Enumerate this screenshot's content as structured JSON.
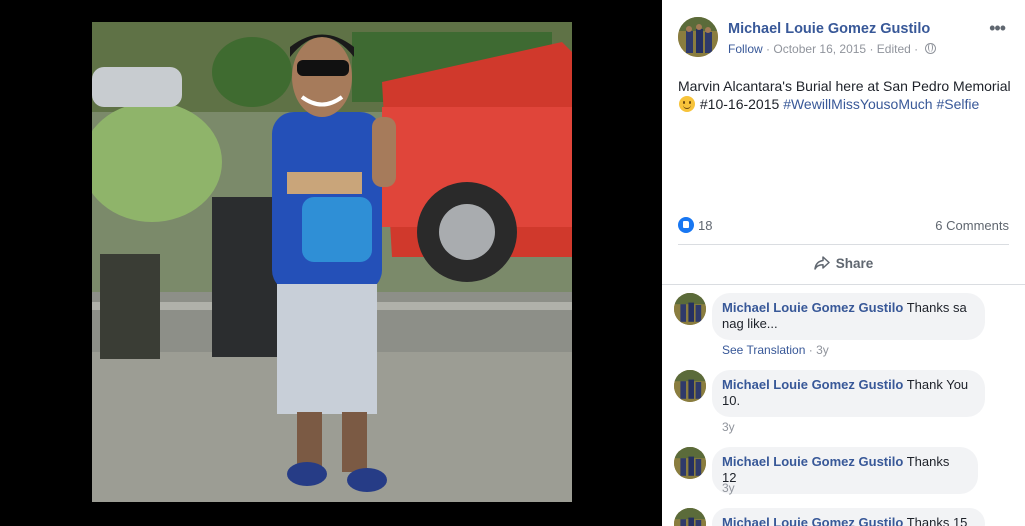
{
  "post": {
    "author": "Michael Louie Gomez Gustilo",
    "follow_label": "Follow",
    "date": "October 16, 2015",
    "edited_label": "Edited",
    "separator": "·",
    "more_icon": "more-options-icon",
    "text_main": "Marvin Alcantara's Burial here at San Pedro Memorial",
    "text_after_emoji": "#10-16-2015",
    "hashtag1": "#WewillMissYousoMuch",
    "hashtag2": "#Selfie"
  },
  "reactions": {
    "like_count": "18",
    "comments_label": "6 Comments"
  },
  "actions": {
    "share_label": "Share"
  },
  "comments": [
    {
      "name": "Michael Louie Gomez Gustilo",
      "text": "Thanks sa nag like...",
      "see_translation": "See Translation",
      "age": "3y"
    },
    {
      "name": "Michael Louie Gomez Gustilo",
      "text": "Thank You 10.",
      "age": "3y"
    },
    {
      "name": "Michael Louie Gomez Gustilo",
      "text": "Thanks 12",
      "age": "3y"
    },
    {
      "name": "Michael Louie Gomez Gustilo",
      "text": "Thanks 15"
    }
  ],
  "colors": {
    "link": "#385898",
    "like_blue": "#1877f2"
  }
}
